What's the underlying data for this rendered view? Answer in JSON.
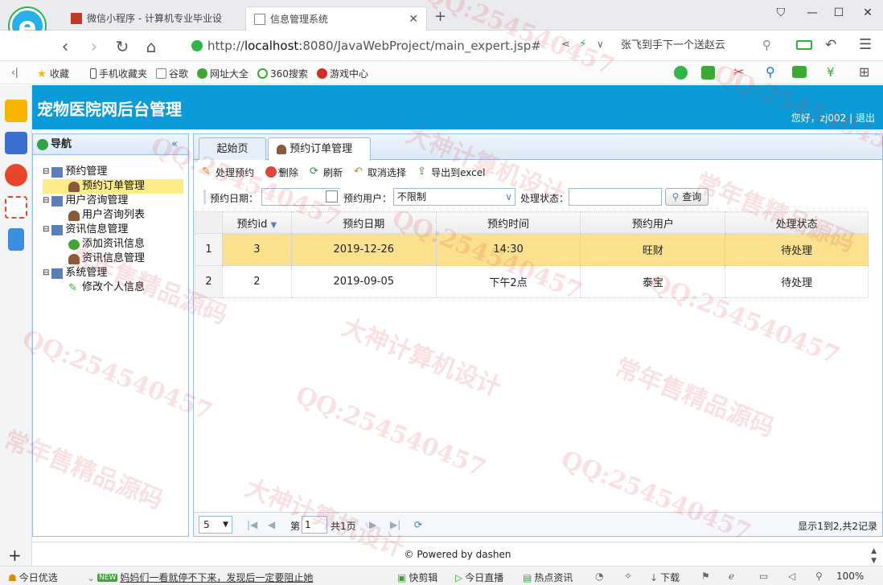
{
  "browser": {
    "tabs": [
      {
        "label": "微信小程序 - 计算机专业毕业设"
      },
      {
        "label": "信息管理系统"
      }
    ],
    "url_prefix": "http://",
    "url_host": "localhost",
    "url_rest": ":8080/JavaWebProject/main_expert.jsp#",
    "search_text": "张飞到手下一个送赵云",
    "bookmarks": [
      "收藏",
      "手机收藏夹",
      "谷歌",
      "网址大全",
      "360搜索",
      "游戏中心"
    ],
    "zoom": "100%",
    "status_items": [
      "今日优选",
      "妈妈们一看就停不下来，发现后一定要阻止她",
      "快剪辑",
      "今日直播",
      "热点资讯",
      "下载"
    ],
    "new_badge": "NEW"
  },
  "app": {
    "title": "宠物医院网后台管理",
    "welcome": "您好，zj002 | 退出",
    "footer": "© Powered by dashen"
  },
  "nav": {
    "title": "导航",
    "tree": [
      {
        "label": "预约管理",
        "children": [
          "预约订单管理"
        ]
      },
      {
        "label": "用户咨询管理",
        "children": [
          "用户咨询列表"
        ]
      },
      {
        "label": "资讯信息管理",
        "children": [
          "添加资讯信息",
          "资讯信息管理"
        ]
      },
      {
        "label": "系统管理",
        "children": [
          "修改个人信息"
        ]
      }
    ]
  },
  "main": {
    "tabs": [
      "起始页",
      "预约订单管理"
    ],
    "toolbar": [
      "处理预约",
      "删除",
      "刷新",
      "取消选择",
      "导出到excel"
    ],
    "filter": {
      "date_label": "预约日期：",
      "user_label": "预约用户：",
      "user_value": "不限制",
      "state_label": "处理状态：",
      "query_label": "查询"
    },
    "grid": {
      "columns": [
        "预约id",
        "预约日期",
        "预约时间",
        "预约用户",
        "处理状态"
      ],
      "rows": [
        {
          "n": "1",
          "id": "3",
          "date": "2019-12-26",
          "time": "14:30",
          "user": "旺财",
          "state": "待处理"
        },
        {
          "n": "2",
          "id": "2",
          "date": "2019-09-05",
          "time": "下午2点",
          "user": "泰宝",
          "state": "待处理"
        }
      ]
    },
    "pager": {
      "page_size": "5",
      "page_label": "第",
      "page_value": "1",
      "total_pages": "共1页",
      "summary": "显示1到2,共2记录"
    }
  },
  "watermarks": [
    "QQ:254540457",
    "大神计算机设计",
    "常年售精品源码"
  ]
}
